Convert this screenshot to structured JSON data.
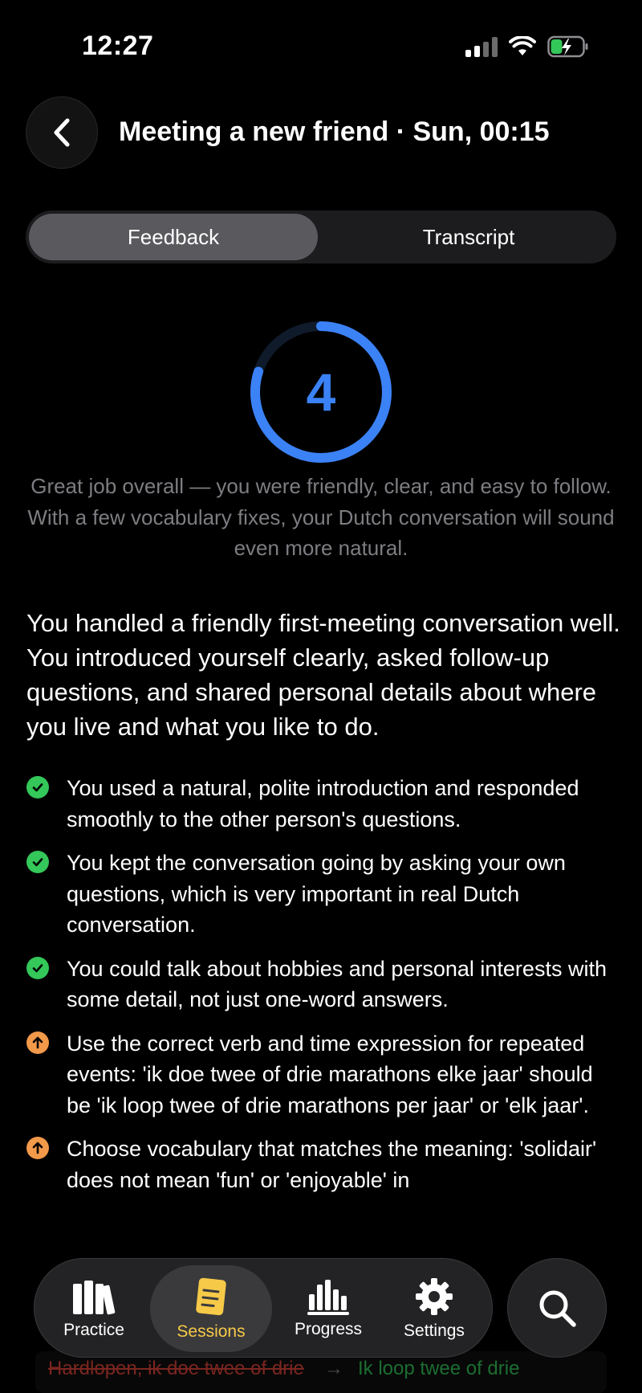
{
  "status_bar": {
    "time": "12:27"
  },
  "header": {
    "title": "Meeting a new friend · Sun, 00:15"
  },
  "tabs": {
    "feedback": "Feedback",
    "transcript": "Transcript"
  },
  "score": {
    "value": "4",
    "progress_fraction": 0.8,
    "color": "#3b82f6"
  },
  "summary": "Great job overall — you were friendly, clear, and easy to follow. With a few vocabulary fixes, your Dutch conversation will sound even more natural.",
  "overview": "You handled a friendly first-meeting conversation well. You introduced yourself clearly, asked follow-up questions, and shared personal details about where you live and what you like to do.",
  "feedback_items": [
    {
      "type": "positive",
      "icon": "check-icon",
      "text": "You used a natural, polite introduction and responded smoothly to the other person's questions."
    },
    {
      "type": "positive",
      "icon": "check-icon",
      "text": "You kept the conversation going by asking your own questions, which is very important in real Dutch conversation."
    },
    {
      "type": "positive",
      "icon": "check-icon",
      "text": "You could talk about hobbies and personal interests with some detail, not just one-word answers."
    },
    {
      "type": "improve",
      "icon": "arrow-up-icon",
      "text": "Use the correct verb and time expression for repeated events: 'ik doe twee of drie marathons elke jaar' should be 'ik loop twee of drie marathons per jaar' or 'elk jaar'."
    },
    {
      "type": "improve",
      "icon": "arrow-up-icon",
      "text": "Choose vocabulary that matches the meaning: 'solidair' does not mean 'fun' or 'enjoyable' in"
    }
  ],
  "correction": {
    "wrong": "Hardlopen, ik doe twee of drie",
    "right": "Ik loop twee of drie"
  },
  "nav": {
    "practice": "Practice",
    "sessions": "Sessions",
    "progress": "Progress",
    "settings": "Settings"
  },
  "colors": {
    "positive": "#34c759",
    "improve": "#f2994a",
    "active_tab": "#f7c948"
  }
}
